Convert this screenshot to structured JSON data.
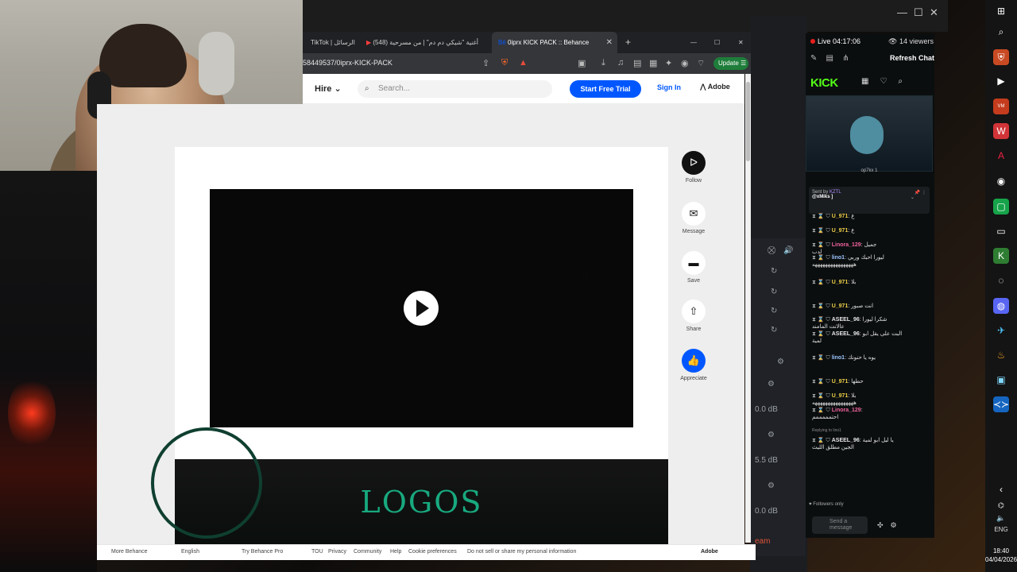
{
  "browser": {
    "tabs": [
      {
        "label": "TikTok | الرسائل",
        "active": false
      },
      {
        "label": "(548) أغنية \"شيكي دم دم\" | من مسرحية",
        "active": false
      },
      {
        "label": "0iprx KICK PACK :: Behance",
        "active": true
      }
    ],
    "new_tab_label": "+",
    "url": "58449537/0iprx-KICK-PACK",
    "update_label": "Update"
  },
  "behance": {
    "hire_label": "Hire",
    "search_placeholder": "Search...",
    "start_trial_label": "Start Free Trial",
    "sign_in_label": "Sign In",
    "adobe_label": "Adobe",
    "side_actions": {
      "follow": "Follow",
      "message": "Message",
      "save": "Save",
      "share": "Share",
      "appreciate": "Appreciate"
    },
    "banner_title": "LOGOS",
    "footer": {
      "more": "More Behance",
      "language": "English",
      "try_pro": "Try Behance Pro",
      "tou": "TOU",
      "privacy": "Privacy",
      "community": "Community",
      "help": "Help",
      "cookies": "Cookie preferences",
      "dnsell": "Do not sell or share my personal information",
      "adobe": "Adobe"
    }
  },
  "daw": {
    "db1": "0.0 dB",
    "db2": "5.5 dB",
    "db3": "0.0 dB",
    "team": "eam"
  },
  "kick": {
    "live": "Live 04:17:06",
    "viewers": "14 viewers",
    "refresh": "Refresh Chat",
    "logo": "KICK",
    "preview_handle": "op7kx 1",
    "pinned_sender": "Sent by",
    "pinned_user": "KZTL",
    "pinned_text": "@xMiks ]",
    "messages": [
      {
        "user": "U_971",
        "text": "ع",
        "color": "#f0d24a"
      },
      {
        "user": "U_971",
        "text": "ع",
        "color": "#f0d24a"
      },
      {
        "user": "Linora_129",
        "text": "جميل",
        "extra": "لدب",
        "color": "#f0639e"
      },
      {
        "user": "lino1",
        "text": "ليورا احبك وربي",
        "extra": "ههههههههههههههههه",
        "color": "#9cc6ff"
      },
      {
        "user": "U_971",
        "text": "بلا",
        "color": "#f0d24a"
      },
      {
        "user": "U_971",
        "text": "انت صبور",
        "color": "#f0d24a"
      },
      {
        "user": "ASEEL_96",
        "text": "شكرا ليورا",
        "extra": "عالانت المامند",
        "color": "#e6e6e6"
      },
      {
        "user": "ASEEL_96",
        "text": "البت على يقل ابو",
        "extra": "لمية",
        "color": "#e6e6e6"
      },
      {
        "user": "lino1",
        "text": "يوه يا حنونك",
        "color": "#9cc6ff"
      },
      {
        "user": "U_971",
        "text": "حطها",
        "color": "#f0d24a"
      },
      {
        "user": "U_971",
        "text": "بلا",
        "extra": "ههههههههههههههههه",
        "color": "#f0d24a"
      },
      {
        "user": "Linora_129",
        "text": "",
        "extra": "احتمممممم",
        "color": "#f0639e"
      },
      {
        "user": "ASEEL_96",
        "text": "يا ليل ابو لمية",
        "extra": "الجين مطلق الليث",
        "color": "#e6e6e6"
      }
    ],
    "replying_to": "Replying to lino1",
    "followers_only": "Followers only",
    "send_placeholder": "Send a message"
  },
  "taskbar": {
    "lang": "ENG",
    "time": "18:40",
    "date": "04/04/2026"
  },
  "colors": {
    "behance_blue": "#0057ff",
    "kick_green": "#53fc18",
    "logos_teal": "#18a97f"
  }
}
